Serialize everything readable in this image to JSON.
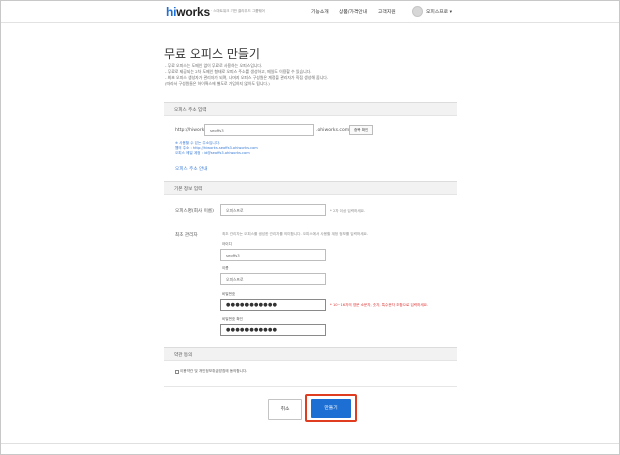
{
  "header": {
    "logo_hi": "hi",
    "logo_works": "works",
    "logo_sub": "· 스마트워크 기반 클라우드 그룹웨어",
    "nav": [
      "기능소개",
      "상품/가격안내",
      "고객지원"
    ],
    "user": "오피스프로 ▾"
  },
  "page": {
    "title": "무료 오피스 만들기",
    "notes": [
      "- 무료 오피스는 도메인 없이 무료로 사용하는 오피스입니다.",
      "- 무료로 제공되는 2차 도메인 형태로 오피스 주소를 생성하고, 메일도 이용할 수 있습니다.",
      "- 최초 오피스 생성자가 관리자가 되며, 나머지 오피스 구성원은 계정을 관리자가 직접 생성해 줍니다.",
      "(따라서 구성원들은 하이웍스에 별도로 가입하지 않아도 됩니다.)"
    ]
  },
  "address_section": {
    "header": "오피스 주소 입력",
    "prefix": "http://hiworks.",
    "input_value": "seoffs3",
    "suffix": ".ohiworks.com",
    "check_button": "중복 확인",
    "hint_ok": "※ 사용할 수 있는 주소입니다.",
    "hint_url": "웹의 주소 : http://hiworks.seoffs3.ohiworks.com",
    "hint_mail": "오피스 메일 계정 : id@seoffs3.ohiworks.com",
    "guide_link": "오피스 주소 안내"
  },
  "basic_section": {
    "header": "기본 정보 입력",
    "company_label": "오피스명(회사 이름)",
    "company_placeholder": "오피스프로",
    "company_hint": "* 2자 이상 입력하세요.",
    "admin_label": "최초 관리자",
    "admin_desc": "최초 관리자는 오피스를 생성한 관리자를 의미합니다. 오피스에서 사용할 계정 정보를 입력하세요.",
    "id_label": "아이디",
    "id_value": "seoffs3",
    "name_label": "이름",
    "name_value": "오피스프로",
    "pw_label": "비밀번호",
    "pw_value": "●●●●●●●●●●●",
    "pw_hint": "* 10~16자의 영문 소문자, 숫자, 특수문자 조합으로 입력하세요.",
    "pw2_label": "비밀번호 확인",
    "pw2_value": "●●●●●●●●●●●"
  },
  "terms_section": {
    "header": "약관 동의",
    "agree_text": "이용약관 및 개인정보취급방침에 동의합니다."
  },
  "buttons": {
    "cancel": "취소",
    "create": "만들기"
  },
  "colors": {
    "accent": "#1e6fd4",
    "highlight": "#e03c1f",
    "link": "#3a7bd5"
  }
}
